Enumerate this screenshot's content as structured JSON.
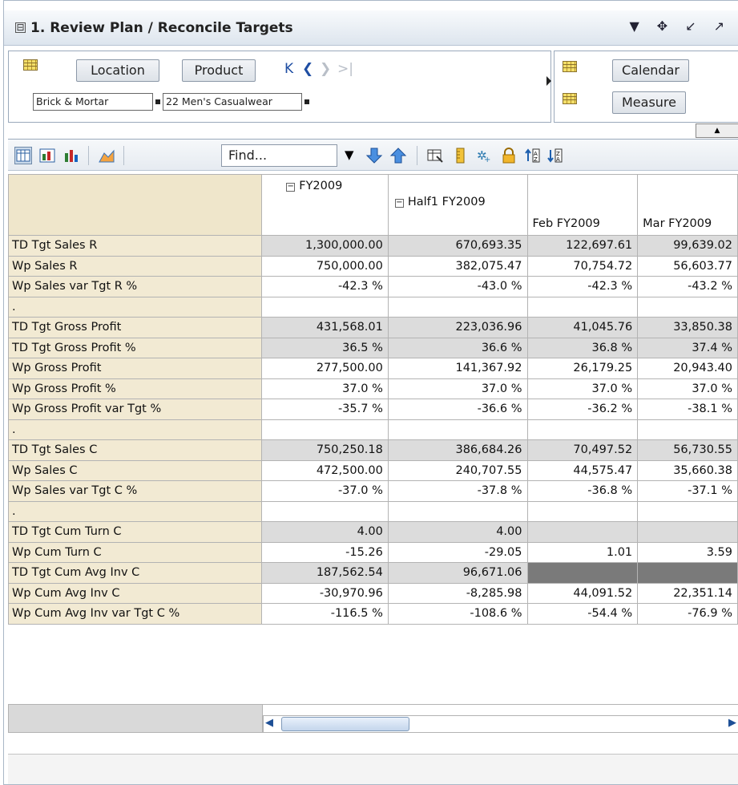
{
  "window": {
    "title": "1. Review Plan / Reconcile Targets",
    "collapse_glyph": "⊟"
  },
  "edge": {
    "row_dims": [
      "Location",
      "Product"
    ],
    "col_dims": [
      "Calendar",
      "Measure"
    ],
    "selections": [
      "Brick & Mortar",
      "22 Men's Casualwear"
    ],
    "nav_icons": [
      "first-icon",
      "prev-icon",
      "next-icon",
      "last-icon"
    ]
  },
  "toolbar": {
    "find_placeholder": "Find...",
    "icons": [
      "table-view-icon",
      "chart-table-icon",
      "bar-chart-icon",
      "area-chart-icon",
      "down-arrow-icon",
      "up-arrow-icon",
      "export-icon",
      "ruler-icon",
      "spread-icon",
      "lock-icon",
      "sort-asc-icon",
      "sort-desc-icon"
    ]
  },
  "grid": {
    "headers": [
      "FY2009",
      "Half1 FY2009",
      "Feb FY2009",
      "Mar FY2009"
    ],
    "rows": [
      {
        "label": "TD Tgt Sales R",
        "values": [
          "1,300,000.00",
          "670,693.35",
          "122,697.61",
          "99,639.02"
        ],
        "shade": "g"
      },
      {
        "label": "Wp Sales R",
        "values": [
          "750,000.00",
          "382,075.47",
          "70,754.72",
          "56,603.77"
        ],
        "shade": "w"
      },
      {
        "label": "Wp Sales var Tgt R %",
        "values": [
          "-42.3 %",
          "-43.0 %",
          "-42.3 %",
          "-43.2 %"
        ],
        "shade": "w"
      },
      {
        "label": ".",
        "values": [
          "",
          "",
          "",
          ""
        ],
        "shade": "w"
      },
      {
        "label": "TD Tgt Gross Profit",
        "values": [
          "431,568.01",
          "223,036.96",
          "41,045.76",
          "33,850.38"
        ],
        "shade": "g"
      },
      {
        "label": "TD Tgt Gross Profit %",
        "values": [
          "36.5 %",
          "36.6 %",
          "36.8 %",
          "37.4 %"
        ],
        "shade": "g"
      },
      {
        "label": "Wp Gross Profit",
        "values": [
          "277,500.00",
          "141,367.92",
          "26,179.25",
          "20,943.40"
        ],
        "shade": "w"
      },
      {
        "label": "Wp Gross Profit %",
        "values": [
          "37.0 %",
          "37.0 %",
          "37.0 %",
          "37.0 %"
        ],
        "shade": "w"
      },
      {
        "label": "Wp Gross Profit var Tgt %",
        "values": [
          "-35.7 %",
          "-36.6 %",
          "-36.2 %",
          "-38.1 %"
        ],
        "shade": "w"
      },
      {
        "label": ".",
        "values": [
          "",
          "",
          "",
          ""
        ],
        "shade": "w"
      },
      {
        "label": "TD Tgt Sales C",
        "values": [
          "750,250.18",
          "386,684.26",
          "70,497.52",
          "56,730.55"
        ],
        "shade": "g"
      },
      {
        "label": "Wp Sales C",
        "values": [
          "472,500.00",
          "240,707.55",
          "44,575.47",
          "35,660.38"
        ],
        "shade": "w"
      },
      {
        "label": "Wp Sales var Tgt C %",
        "values": [
          "-37.0 %",
          "-37.8 %",
          "-36.8 %",
          "-37.1 %"
        ],
        "shade": "w"
      },
      {
        "label": ".",
        "values": [
          "",
          "",
          "",
          ""
        ],
        "shade": "w"
      },
      {
        "label": "TD Tgt Cum Turn C",
        "values": [
          "4.00",
          "4.00",
          "",
          ""
        ],
        "shade": "g"
      },
      {
        "label": "Wp Cum Turn C",
        "values": [
          "-15.26",
          "-29.05",
          "1.01",
          "3.59"
        ],
        "shade": "w"
      },
      {
        "label": "TD Tgt Cum Avg Inv C",
        "values": [
          "187,562.54",
          "96,671.06",
          "",
          ""
        ],
        "shade": "g",
        "dark_from": 2
      },
      {
        "label": "Wp Cum Avg Inv C",
        "values": [
          "-30,970.96",
          "-8,285.98",
          "44,091.52",
          "22,351.14"
        ],
        "shade": "w"
      },
      {
        "label": "Wp Cum Avg Inv var Tgt C %",
        "values": [
          "-116.5 %",
          "-108.6 %",
          "-54.4 %",
          "-76.9 %"
        ],
        "shade": "w"
      }
    ]
  },
  "colors": {
    "label_bg": "#f2ead3",
    "target_bg": "#dcdcdc",
    "protected_bg": "#7a7a7a"
  }
}
